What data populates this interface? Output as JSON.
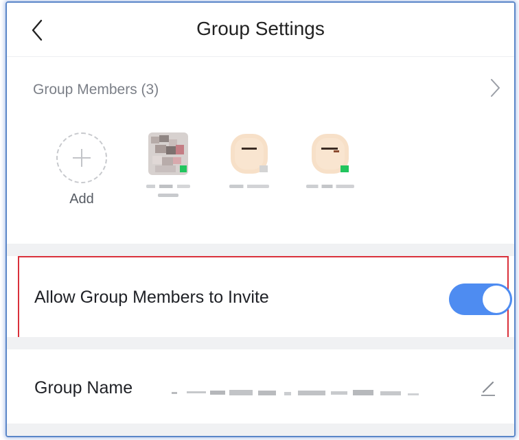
{
  "header": {
    "title": "Group Settings",
    "back_icon": "chevron-left-icon"
  },
  "members_section": {
    "label": "Group Members (3)",
    "chevron_icon": "chevron-right-icon",
    "add_label": "Add",
    "add_icon": "plus-icon",
    "members": [
      {
        "avatar": "pixelated-photo-avatar",
        "status_color": "#22c55e"
      },
      {
        "avatar": "peach-avatar",
        "status_color": "#d4d4d4"
      },
      {
        "avatar": "peach-avatar",
        "status_color": "#22c55e"
      }
    ]
  },
  "invite_setting": {
    "label": "Allow Group Members to Invite",
    "enabled": true,
    "toggle_color": "#4e8cf1",
    "highlight_color": "#d9303a"
  },
  "group_name": {
    "label": "Group Name",
    "edit_icon": "pencil-icon"
  },
  "colors": {
    "accent": "#4e8cf1",
    "frame_border": "#5a86c8"
  }
}
